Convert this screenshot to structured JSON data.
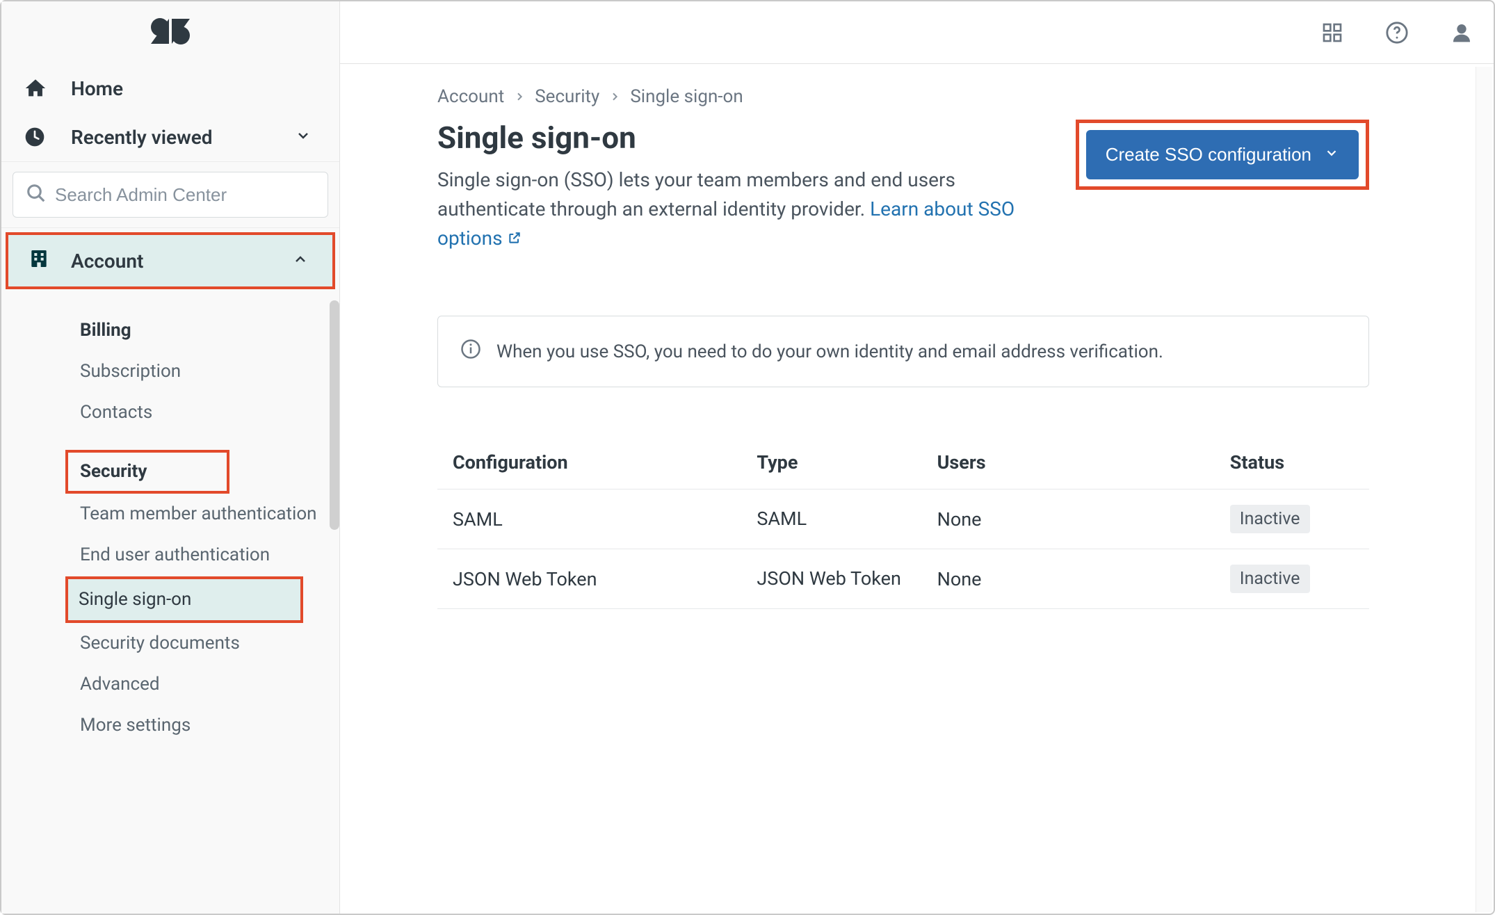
{
  "sidebar": {
    "home": "Home",
    "recently_viewed": "Recently viewed",
    "search_placeholder": "Search Admin Center",
    "account_label": "Account",
    "items": {
      "billing": "Billing",
      "subscription": "Subscription",
      "contacts": "Contacts",
      "security": "Security",
      "team_auth": "Team member authentication",
      "end_user_auth": "End user authentication",
      "sso": "Single sign-on",
      "sec_docs": "Security documents",
      "advanced": "Advanced",
      "more_settings": "More settings"
    }
  },
  "breadcrumb": {
    "a": "Account",
    "b": "Security",
    "c": "Single sign-on"
  },
  "header": {
    "title": "Single sign-on",
    "desc_part1": "Single sign-on (SSO) lets your team members and end users authenticate through an external identity provider. ",
    "link_text": "Learn about SSO options",
    "cta": "Create SSO configuration"
  },
  "banner": "When you use SSO, you need to do your own identity and email address verification.",
  "table": {
    "headers": {
      "config": "Configuration",
      "type": "Type",
      "users": "Users",
      "status": "Status"
    },
    "rows": [
      {
        "config": "SAML",
        "type": "SAML",
        "users": "None",
        "status": "Inactive"
      },
      {
        "config": "JSON Web Token",
        "type": "JSON Web Token",
        "users": "None",
        "status": "Inactive"
      }
    ]
  }
}
